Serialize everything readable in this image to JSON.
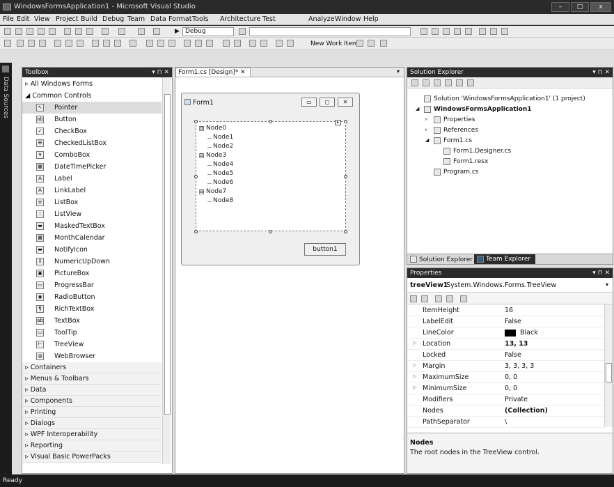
{
  "window": {
    "title": "WindowsFormsApplication1 - Microsoft Visual Studio",
    "min": "–",
    "max": "□",
    "close": "x"
  },
  "menu": [
    "File",
    "Edit",
    "View",
    "Project",
    "Build",
    "Debug",
    "Team",
    "Data",
    "Format",
    "Tools",
    "Architecture",
    "Test",
    "Analyze",
    "Window",
    "Help"
  ],
  "toolbar": {
    "config": "Debug",
    "new_work_item": "New Work Item ▾"
  },
  "data_sources_label": "Data Sources",
  "toolbox": {
    "title": "Toolbox",
    "pins": "▾ ⊓ ✕",
    "groups_top": [
      "▹ All Windows Forms",
      "◢ Common Controls"
    ],
    "items": [
      {
        "label": "Pointer",
        "icon": "pointer-icon",
        "glyph": "↖"
      },
      {
        "label": "Button",
        "icon": "button-icon",
        "glyph": "ab"
      },
      {
        "label": "CheckBox",
        "icon": "checkbox-icon",
        "glyph": "✓"
      },
      {
        "label": "CheckedListBox",
        "icon": "checkedlistbox-icon",
        "glyph": "☰"
      },
      {
        "label": "ComboBox",
        "icon": "combobox-icon",
        "glyph": "▾"
      },
      {
        "label": "DateTimePicker",
        "icon": "datetimepicker-icon",
        "glyph": "▦"
      },
      {
        "label": "Label",
        "icon": "label-icon",
        "glyph": "A"
      },
      {
        "label": "LinkLabel",
        "icon": "linklabel-icon",
        "glyph": "A"
      },
      {
        "label": "ListBox",
        "icon": "listbox-icon",
        "glyph": "≡"
      },
      {
        "label": "ListView",
        "icon": "listview-icon",
        "glyph": "⋮"
      },
      {
        "label": "MaskedTextBox",
        "icon": "maskedtextbox-icon",
        "glyph": "▬"
      },
      {
        "label": "MonthCalendar",
        "icon": "monthcalendar-icon",
        "glyph": "▦"
      },
      {
        "label": "NotifyIcon",
        "icon": "notifyicon-icon",
        "glyph": "▬"
      },
      {
        "label": "NumericUpDown",
        "icon": "numericupdown-icon",
        "glyph": "↕"
      },
      {
        "label": "PictureBox",
        "icon": "picturebox-icon",
        "glyph": "▣"
      },
      {
        "label": "ProgressBar",
        "icon": "progressbar-icon",
        "glyph": "▭"
      },
      {
        "label": "RadioButton",
        "icon": "radiobutton-icon",
        "glyph": "◉"
      },
      {
        "label": "RichTextBox",
        "icon": "richtextbox-icon",
        "glyph": "¶"
      },
      {
        "label": "TextBox",
        "icon": "textbox-icon",
        "glyph": "ab"
      },
      {
        "label": "ToolTip",
        "icon": "tooltip-icon",
        "glyph": "▭"
      },
      {
        "label": "TreeView",
        "icon": "treeview-icon",
        "glyph": "⊢"
      },
      {
        "label": "WebBrowser",
        "icon": "webbrowser-icon",
        "glyph": "◍"
      }
    ],
    "groups_bottom": [
      "▹ Containers",
      "▹ Menus & Toolbars",
      "▹ Data",
      "▹ Components",
      "▹ Printing",
      "▹ Dialogs",
      "▹ WPF Interoperability",
      "▹ Reporting",
      "▹ Visual Basic PowerPacks"
    ]
  },
  "designer": {
    "tab": "Form1.cs [Design]*",
    "tab_close": "✕",
    "form_title": "Form1",
    "button_label": "button1",
    "nodes": [
      {
        "text": "Node0",
        "level": 0,
        "expander": "⊟"
      },
      {
        "text": "Node1",
        "level": 1
      },
      {
        "text": "Node2",
        "level": 1
      },
      {
        "text": "Node3",
        "level": 0,
        "expander": "⊟"
      },
      {
        "text": "Node4",
        "level": 1
      },
      {
        "text": "Node5",
        "level": 1
      },
      {
        "text": "Node6",
        "level": 1
      },
      {
        "text": "Node7",
        "level": 0,
        "expander": "⊟"
      },
      {
        "text": "Node8",
        "level": 1
      }
    ]
  },
  "solution_explorer": {
    "title": "Solution Explorer",
    "pins": "▾ ⊓ ✕",
    "items": [
      {
        "text": "Solution 'WindowsFormsApplication1' (1 project)",
        "level": 0,
        "bold": false,
        "exp": ""
      },
      {
        "text": "WindowsFormsApplication1",
        "level": 0,
        "bold": true,
        "exp": "◢"
      },
      {
        "text": "Properties",
        "level": 1,
        "bold": false,
        "exp": "▹"
      },
      {
        "text": "References",
        "level": 1,
        "bold": false,
        "exp": "▹"
      },
      {
        "text": "Form1.cs",
        "level": 1,
        "bold": false,
        "exp": "◢"
      },
      {
        "text": "Form1.Designer.cs",
        "level": 2,
        "bold": false,
        "exp": ""
      },
      {
        "text": "Form1.resx",
        "level": 2,
        "bold": false,
        "exp": ""
      },
      {
        "text": "Program.cs",
        "level": 1,
        "bold": false,
        "exp": ""
      }
    ],
    "tab1": "Solution Explorer",
    "tab2": "Team Explorer"
  },
  "properties": {
    "title": "Properties",
    "pins": "▾ ⊓ ✕",
    "object_name": "treeView1",
    "object_type": "System.Windows.Forms.TreeView",
    "rows": [
      {
        "name": "ItemHeight",
        "value": "16",
        "bold": false,
        "exp": ""
      },
      {
        "name": "LabelEdit",
        "value": "False",
        "bold": false,
        "exp": ""
      },
      {
        "name": "LineColor",
        "value": "Black",
        "bold": false,
        "exp": "",
        "swatch": "#000000"
      },
      {
        "name": "Location",
        "value": "13, 13",
        "bold": true,
        "exp": "▷"
      },
      {
        "name": "Locked",
        "value": "False",
        "bold": false,
        "exp": ""
      },
      {
        "name": "Margin",
        "value": "3, 3, 3, 3",
        "bold": false,
        "exp": "▷"
      },
      {
        "name": "MaximumSize",
        "value": "0, 0",
        "bold": false,
        "exp": "▷"
      },
      {
        "name": "MinimumSize",
        "value": "0, 0",
        "bold": false,
        "exp": "▷"
      },
      {
        "name": "Modifiers",
        "value": "Private",
        "bold": false,
        "exp": ""
      },
      {
        "name": "Nodes",
        "value": "(Collection)",
        "bold": true,
        "exp": ""
      },
      {
        "name": "PathSeparator",
        "value": "\\",
        "bold": false,
        "exp": ""
      }
    ],
    "desc_title": "Nodes",
    "desc_text": "The root nodes in the TreeView control."
  },
  "status": "Ready"
}
